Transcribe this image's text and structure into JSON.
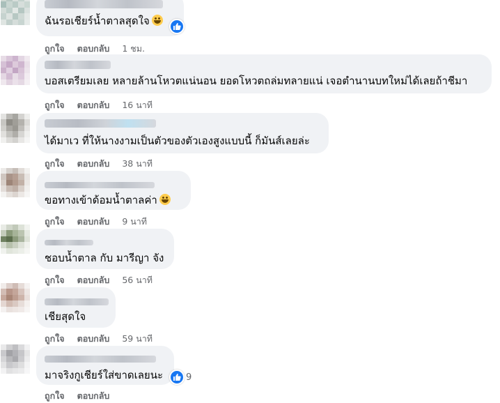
{
  "comments": [
    {
      "text": "ฉันรอเชียร์น้ำตาลสุดใจ",
      "like": "ถูกใจ",
      "reply": "ตอบกลับ",
      "time": "1 ชม.",
      "emoji": "laughing-emoji",
      "reaction": "like",
      "reaction_count": ""
    },
    {
      "text": "บอสเตรียมเลย หลายล้านโหวตแน่นอน ยอดโหวตถล่มทลายแน่ เจอตำนานบทใหม่ได้เลยถ้าชีมา",
      "like": "ถูกใจ",
      "reply": "ตอบกลับ",
      "time": "16 นาที"
    },
    {
      "text": "ได้มาเว ที่ให้นางงามเป็นตัวของตัวเองสูงแบบนี้ ก็มันส์เลยล่ะ",
      "like": "ถูกใจ",
      "reply": "ตอบกลับ",
      "time": "38 นาที"
    },
    {
      "text": "ขอทางเข้าด้อมน้ำตาลค่า",
      "like": "ถูกใจ",
      "reply": "ตอบกลับ",
      "time": "9 นาที",
      "emoji": "grinning-emoji"
    },
    {
      "text": "ชอบน้ำตาล กับ มารีญา จัง",
      "like": "ถูกใจ",
      "reply": "ตอบกลับ",
      "time": "56 นาที"
    },
    {
      "text": "เชียสุดใจ",
      "like": "ถูกใจ",
      "reply": "ตอบกลับ",
      "time": "59 นาที"
    },
    {
      "text": "มาจริงกูเชียร์ใส่ขาดเลยนะ",
      "like": "ถูกใจ",
      "reply": "ตอบกลับ",
      "time": "",
      "reaction": "like",
      "reaction_count": "9"
    }
  ],
  "colors": {
    "bubble": "#f0f2f5",
    "meta": "#65676b",
    "like": "#1877f2"
  }
}
